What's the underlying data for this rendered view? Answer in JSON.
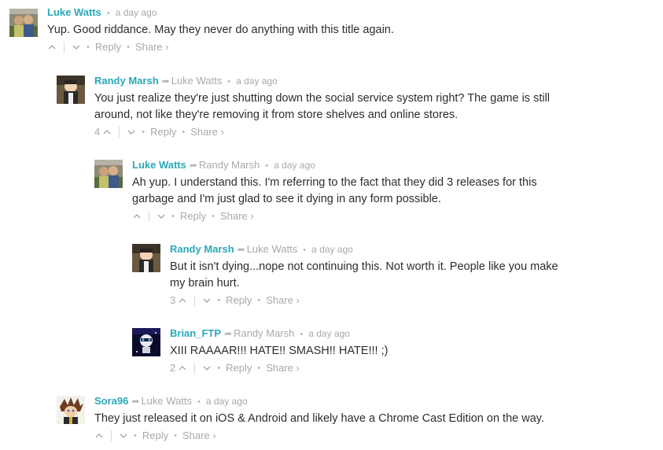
{
  "comments": [
    {
      "author": "Luke Watts",
      "parent": "",
      "time": "a day ago",
      "text": "Yup. Good riddance. May they never do anything with this title again.",
      "votes": "",
      "reply_label": "Reply",
      "share_label": "Share ›"
    },
    {
      "author": "Randy Marsh",
      "parent": "Luke Watts",
      "time": "a day ago",
      "text": "You just realize they're just shutting down the social service system right? The game is still around, not like they're removing it from store shelves and online stores.",
      "votes": "4",
      "reply_label": "Reply",
      "share_label": "Share ›"
    },
    {
      "author": "Luke Watts",
      "parent": "Randy Marsh",
      "time": "a day ago",
      "text": "Ah yup. I understand this. I'm referring to the fact that they did 3 releases for this garbage and I'm just glad to see it dying in any form possible.",
      "votes": "",
      "reply_label": "Reply",
      "share_label": "Share ›"
    },
    {
      "author": "Randy Marsh",
      "parent": "Luke Watts",
      "time": "a day ago",
      "text": "But it isn't dying...nope not continuing this. Not worth it. People like you make my brain hurt.",
      "votes": "3",
      "reply_label": "Reply",
      "share_label": "Share ›"
    },
    {
      "author": "Brian_FTP",
      "parent": "Randy Marsh",
      "time": "a day ago",
      "text": "XIII RAAAAR!!! HATE!! SMASH!! HATE!!! ;)",
      "votes": "2",
      "reply_label": "Reply",
      "share_label": "Share ›"
    },
    {
      "author": "Sora96",
      "parent": "Luke Watts",
      "time": "a day ago",
      "text": "They just released it on iOS & Android and likely have a Chrome Cast Edition on the way.",
      "votes": "",
      "reply_label": "Reply",
      "share_label": "Share ›"
    }
  ],
  "colors": {
    "author": "#2aa8b8",
    "meta": "#a6a9ab",
    "text": "#2a2e2e"
  }
}
